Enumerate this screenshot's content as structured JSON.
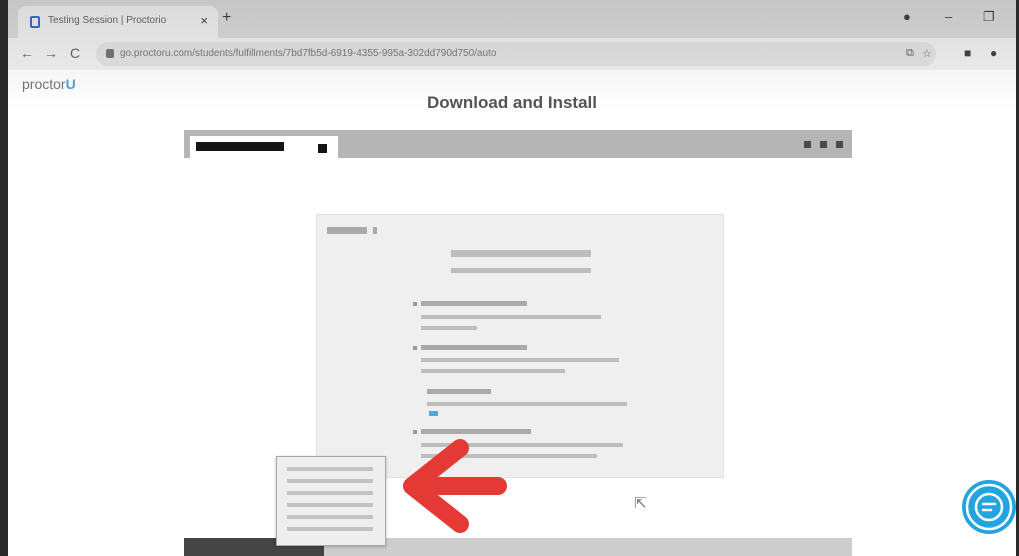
{
  "browser": {
    "tab_title": "Testing Session | Proctorio",
    "close_tab_glyph": "×",
    "new_tab_glyph": "+",
    "url": "go.proctoru.com/students/fulfillments/7bd7fb5d-6919-4355-995a-302dd790d750/auto",
    "window_controls": [
      "●",
      "–",
      "❐"
    ]
  },
  "nav": {
    "back": "←",
    "forward": "→",
    "reload": "C"
  },
  "page": {
    "logo_text": "proctor",
    "logo_badge": "U",
    "heading": "Download and Install"
  },
  "icons": {
    "cursor": "pointer-cursor-icon",
    "chat": "chat-bubble-icon",
    "arrow": "red-arrow-icon",
    "document": "document-icon"
  },
  "colors": {
    "arrow": "#e53935",
    "chat": "#22a4e0",
    "logo_accent": "#4aa7e0"
  }
}
